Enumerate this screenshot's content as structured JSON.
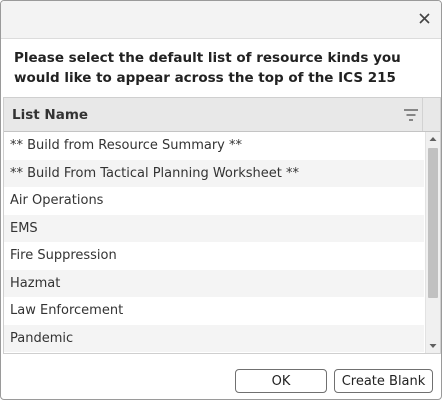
{
  "dialog": {
    "message": "Please select the default list of resource kinds you would like to appear across the top of the ICS 215"
  },
  "grid": {
    "header": "List Name",
    "rows": [
      "** Build from Resource Summary **",
      "** Build From Tactical Planning Worksheet **",
      "Air Operations",
      "EMS",
      "Fire Suppression",
      "Hazmat",
      "Law Enforcement",
      "Pandemic"
    ]
  },
  "buttons": {
    "ok": "OK",
    "create_blank": "Create Blank"
  },
  "icons": {
    "close": "close-icon",
    "filter": "filter-icon",
    "scroll_up": "chevron-up-icon",
    "scroll_down": "chevron-down-icon"
  }
}
